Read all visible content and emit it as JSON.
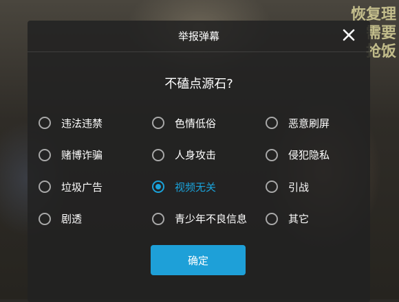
{
  "background": {
    "caption_lines": [
      "恢复理",
      "需要",
      "抢饭"
    ]
  },
  "dialog": {
    "title": "举报弹幕",
    "question": "不磕点源石?",
    "options": [
      {
        "label": "违法违禁",
        "selected": false
      },
      {
        "label": "色情低俗",
        "selected": false
      },
      {
        "label": "恶意刷屏",
        "selected": false
      },
      {
        "label": "赌博诈骗",
        "selected": false
      },
      {
        "label": "人身攻击",
        "selected": false
      },
      {
        "label": "侵犯隐私",
        "selected": false
      },
      {
        "label": "垃圾广告",
        "selected": false
      },
      {
        "label": "视频无关",
        "selected": true
      },
      {
        "label": "引战",
        "selected": false
      },
      {
        "label": "剧透",
        "selected": false
      },
      {
        "label": "青少年不良信息",
        "selected": false
      },
      {
        "label": "其它",
        "selected": false
      }
    ],
    "confirm_label": "确定",
    "close_icon": "close-icon"
  },
  "colors": {
    "accent": "#1aa3db",
    "button": "#1ea0d8",
    "overlay": "rgba(34,34,34,0.86)"
  }
}
